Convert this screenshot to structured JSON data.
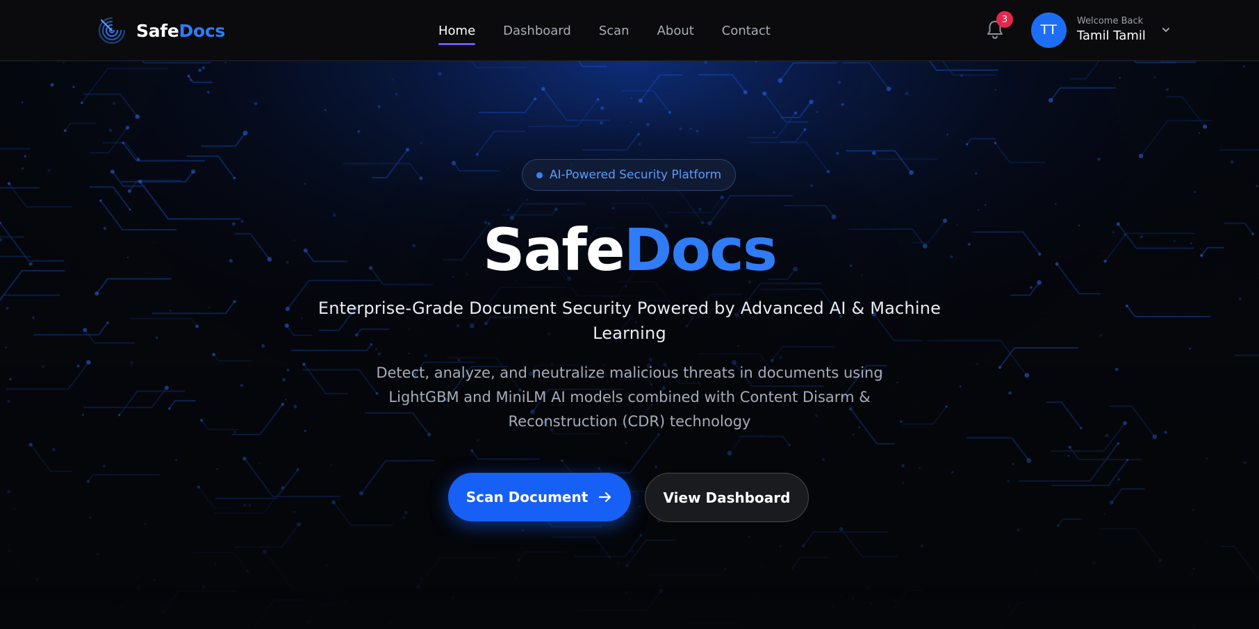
{
  "brand": {
    "logo_icon": "radar-logo-icon",
    "name_part1": "Safe",
    "name_part2": "Docs",
    "accent_color": "#2f7cf6"
  },
  "nav": {
    "items": [
      {
        "label": "Home",
        "active": true
      },
      {
        "label": "Dashboard",
        "active": false
      },
      {
        "label": "Scan",
        "active": false
      },
      {
        "label": "About",
        "active": false
      },
      {
        "label": "Contact",
        "active": false
      }
    ]
  },
  "notifications": {
    "icon": "bell-icon",
    "count": "3",
    "badge_color": "#e8264a"
  },
  "user": {
    "initials": "TT",
    "welcome": "Welcome Back",
    "name": "Tamil Tamil",
    "avatar_color": "#1d6ef5",
    "dropdown_icon": "chevron-down-icon"
  },
  "hero": {
    "pill_text": "AI-Powered Security Platform",
    "title_part1": "Safe",
    "title_part2": "Docs",
    "subtitle": "Enterprise-Grade Document Security Powered by Advanced AI & Machine Learning",
    "description": "Detect, analyze, and neutralize malicious threats in documents using LightGBM and MiniLM AI models combined with Content Disarm & Reconstruction (CDR) technology",
    "primary_button": "Scan Document",
    "primary_button_icon": "arrow-right-icon",
    "secondary_button": "View Dashboard",
    "primary_color": "#1760f5"
  }
}
